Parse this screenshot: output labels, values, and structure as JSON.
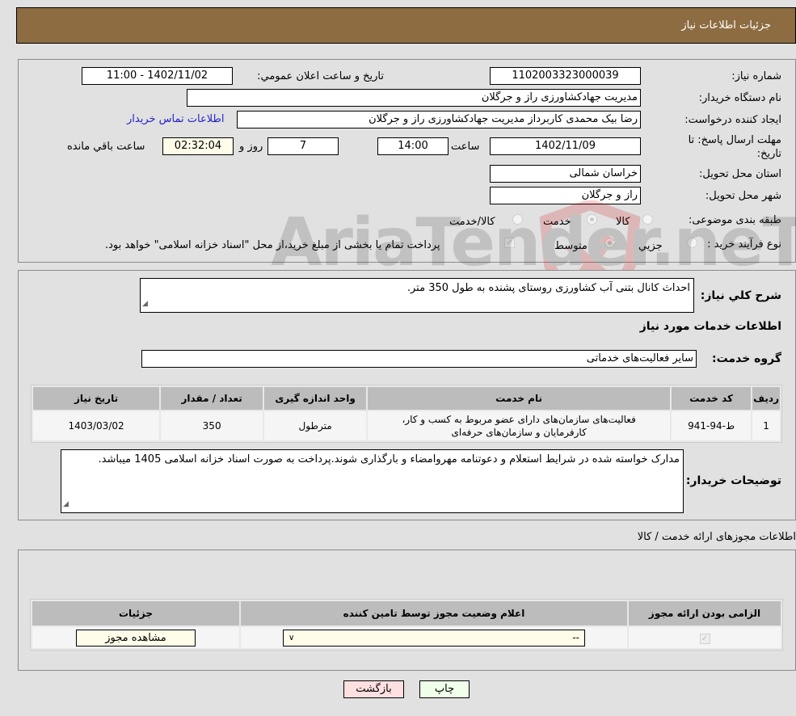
{
  "header": {
    "title": "جزئيات اطلاعات نياز"
  },
  "form": {
    "need_number": {
      "label": "شماره نياز:",
      "value": "1102003323000039"
    },
    "announce_datetime": {
      "label": "تاريخ و ساعت اعلان عمومي:",
      "value": "1402/11/02 - 11:00"
    },
    "buyer_org": {
      "label": "نام دستگاه خريدار:",
      "value": "مديريت جهادكشاورزی راز و جرگلان"
    },
    "requester": {
      "label": "ايجاد کننده درخواست:",
      "value": "رضا  بيک محمدی کاربرداز مديريت جهادکشاورزی راز و جرگلان",
      "contact_link": "اطلاعات تماس خريدار"
    },
    "deadline": {
      "label": "مهلت ارسال پاسخ: تا تاريخ:",
      "date": "1402/11/09",
      "time_label": "ساعت",
      "time": "14:00",
      "days": "7",
      "days_label": "روز و",
      "remaining": "02:32:04",
      "remaining_label": "ساعت باقي مانده"
    },
    "province": {
      "label": "استان محل تحويل:",
      "value": "خراسان شمالی"
    },
    "city": {
      "label": "شهر محل تحويل:",
      "value": "راز و جرگلان"
    },
    "category": {
      "label": "طبقه بندی موضوعی:",
      "options": [
        "کالا",
        "خدمت",
        "کالا/خدمت"
      ],
      "selected": "خدمت"
    },
    "process": {
      "label": "نوع فرآيند خريد :",
      "options": [
        "جزيي",
        "متوسط"
      ],
      "selected": "متوسط",
      "payment_note": "پرداخت تمام يا بخشی از مبلغ خريد،از محل \"اسناد خزانه اسلامی\" خواهد بود."
    }
  },
  "description": {
    "label": "شرح كلي نياز:",
    "value": "احداث کانال بتنی آب کشاورزی روستای پشنده به طول 350 متر."
  },
  "services_title": "اطلاعات خدمات مورد نياز",
  "service_group": {
    "label": "گروه خدمت:",
    "value": "ساير فعاليت‌های خدماتی"
  },
  "services_table": {
    "headers": [
      "رديف",
      "کد خدمت",
      "نام خدمت",
      "واحد اندازه گيری",
      "تعداد / مقدار",
      "تاريخ نياز"
    ],
    "rows": [
      {
        "row": "1",
        "code": "ط-94-941",
        "name": "فعاليت‌های سازمان‌های دارای عضو مربوط به کسب و کار، کارفرمايان و سازمان‌های حرفه‌ای",
        "unit": "مترطول",
        "qty": "350",
        "date": "1403/03/02"
      }
    ]
  },
  "buyer_notes": {
    "label": "توضيحات خريدار:",
    "value": "مدارک خواسته شده در شرايط استعلام و دعوتنامه مهروامضاء و بارگذاری شوند.پرداخت به صورت اسناد خزانه اسلامی 1405 ميباشد."
  },
  "permits": {
    "title": "اطلاعات مجوزهای ارائه خدمت / کالا",
    "headers": [
      "الزامی بودن ارائه مجوز",
      "اعلام وضعيت مجوز توسط تامين کننده",
      "جزئيات"
    ],
    "row": {
      "required_checked": true,
      "status_value": "--",
      "details_button": "مشاهده مجوز"
    }
  },
  "buttons": {
    "print": "چاپ",
    "back": "بازگشت"
  },
  "watermark": "AriaTender.neT"
}
